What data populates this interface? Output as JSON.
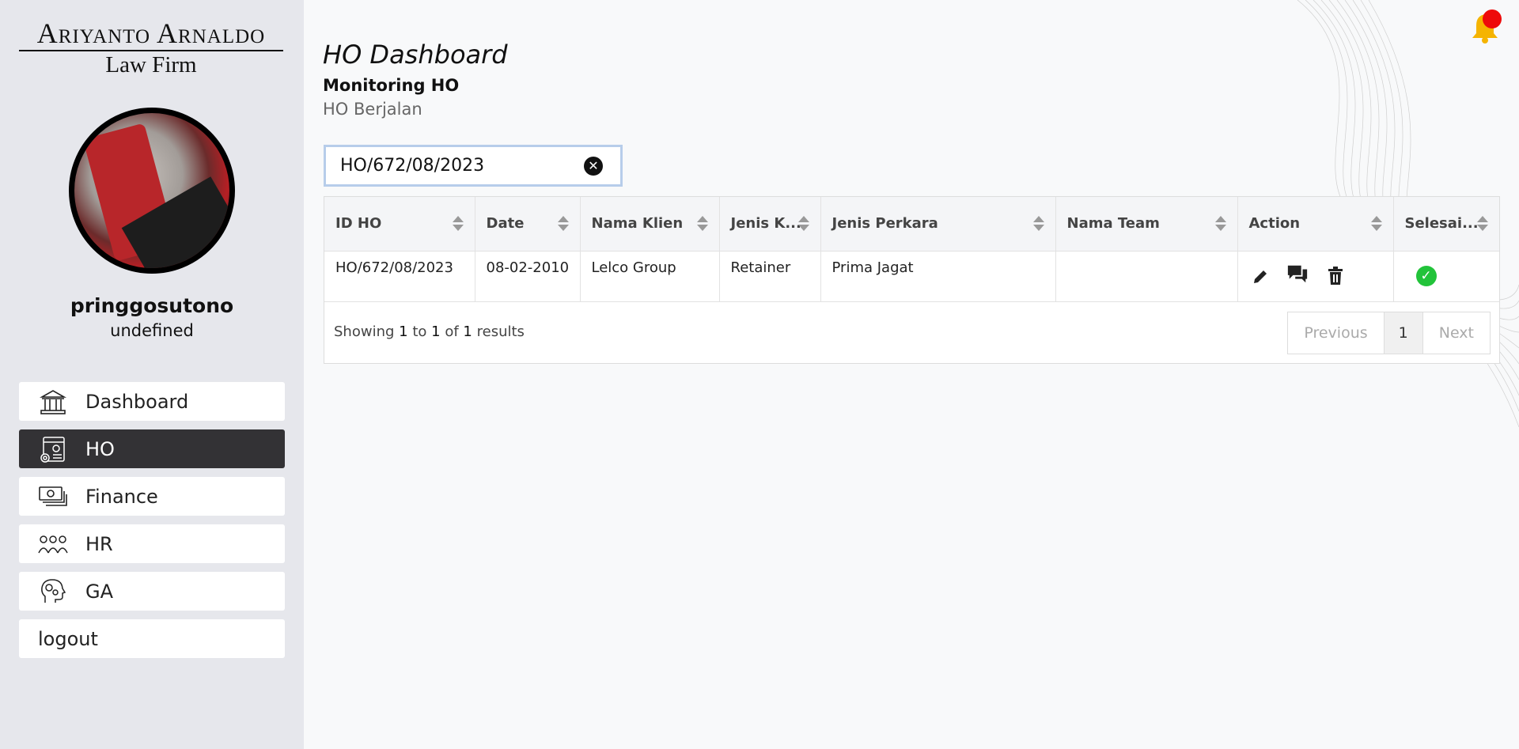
{
  "brand": {
    "line1": "Ariyanto Arnaldo",
    "line2": "Law Firm"
  },
  "user": {
    "name": "pringgosutono",
    "role": "undefined"
  },
  "nav": [
    {
      "label": "Dashboard",
      "icon": "bank-building-icon",
      "active": false
    },
    {
      "label": "HO",
      "icon": "settings-document-icon",
      "active": true
    },
    {
      "label": "Finance",
      "icon": "money-cash-icon",
      "active": false
    },
    {
      "label": "HR",
      "icon": "people-group-icon",
      "active": false
    },
    {
      "label": "GA",
      "icon": "head-gears-icon",
      "active": false
    },
    {
      "label": "logout"
    }
  ],
  "page": {
    "title": "HO Dashboard",
    "subtitle": "Monitoring HO",
    "section": "HO Berjalan"
  },
  "search": {
    "value": "HO/672/08/2023"
  },
  "table": {
    "headers": [
      "ID HO",
      "Date",
      "Nama Klien",
      "Jenis K...",
      "Jenis Perkara",
      "Nama Team",
      "Action",
      "Selesai..."
    ],
    "rows": [
      {
        "id": "HO/672/08/2023",
        "date": "08-02-2010",
        "klien": "Lelco Group",
        "jenis_k": "Retainer",
        "perkara": "Prima Jagat",
        "team": ""
      }
    ]
  },
  "footer": {
    "showing_prefix": "Showing",
    "from": "1",
    "to_word": "to",
    "to": "1",
    "of_word": "of",
    "total": "1",
    "results_word": "results"
  },
  "pagination": {
    "previous": "Previous",
    "current": "1",
    "next": "Next"
  },
  "colors": {
    "active_nav": "#333235",
    "bell": "#f5b400",
    "badge": "#ee0a0a",
    "check": "#22c33a"
  }
}
